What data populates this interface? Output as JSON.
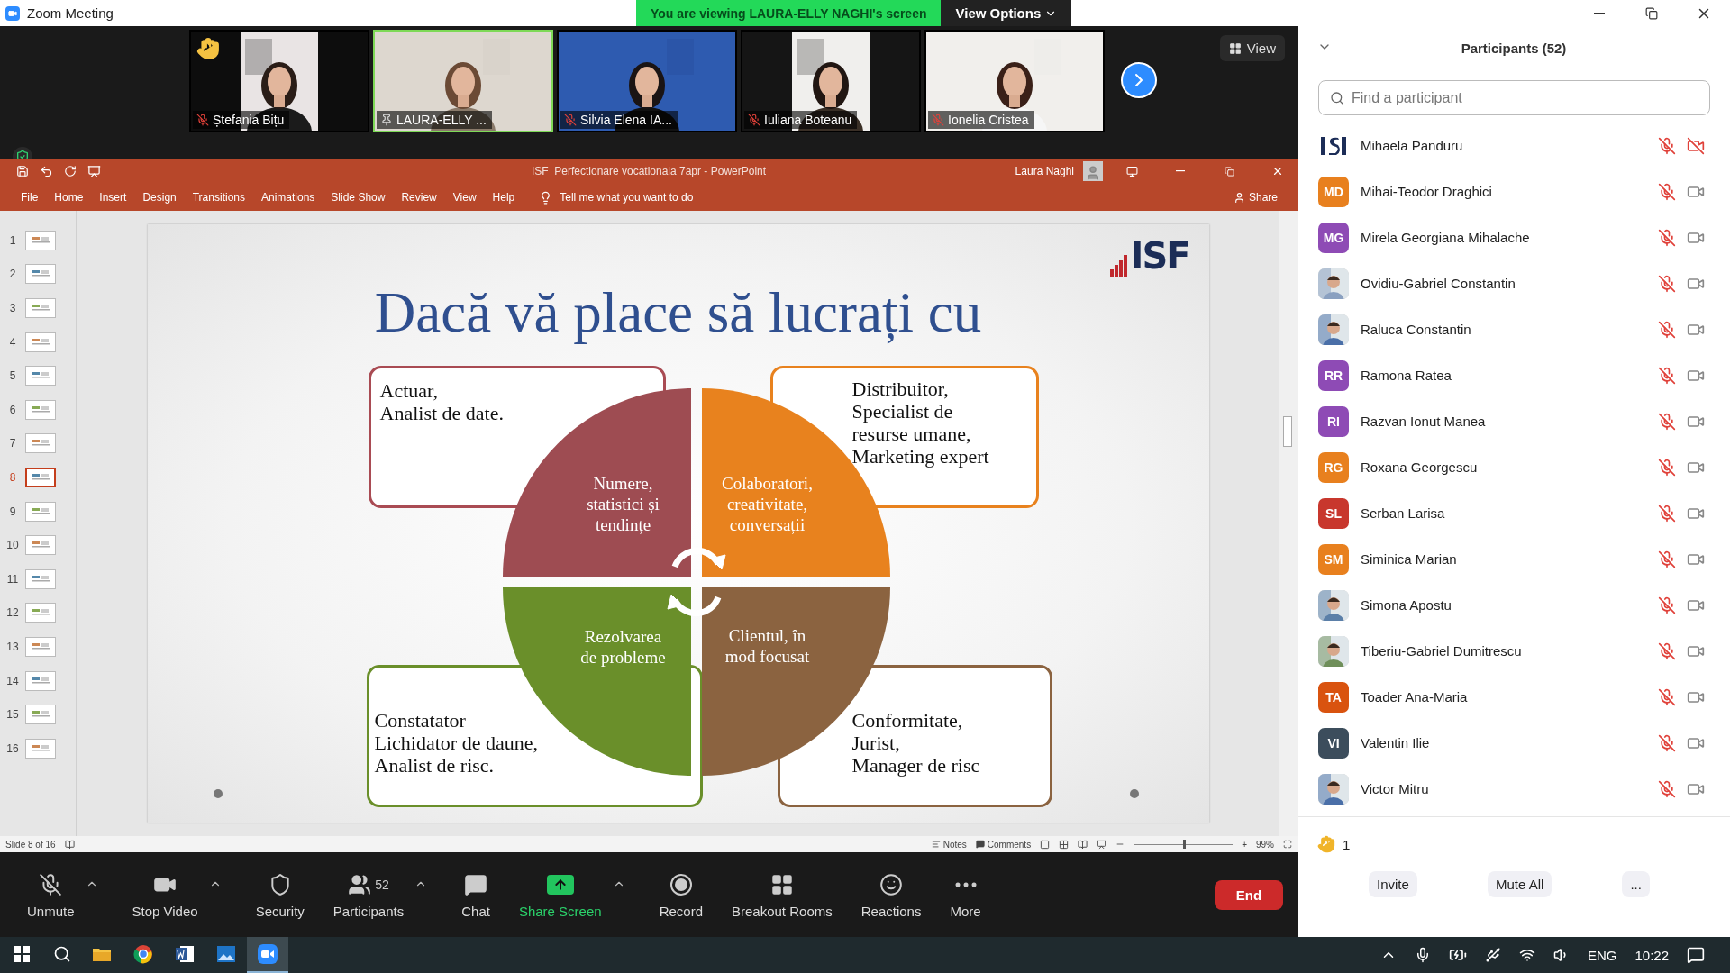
{
  "window": {
    "title": "Zoom Meeting"
  },
  "share_banner": {
    "text": "You are viewing LAURA-ELLY NAGHI's screen",
    "options": "View Options"
  },
  "videos": [
    {
      "name": "Ștefania Bițu",
      "muted": true,
      "pinned": false,
      "hand_raised": true,
      "active": false
    },
    {
      "name": "LAURA-ELLY ...",
      "muted": false,
      "pinned": true,
      "hand_raised": false,
      "active": true
    },
    {
      "name": "Silvia Elena IA...",
      "muted": true,
      "pinned": false,
      "hand_raised": false,
      "active": false
    },
    {
      "name": "Iuliana Boteanu",
      "muted": true,
      "pinned": false,
      "hand_raised": false,
      "active": false
    },
    {
      "name": "Ionelia Cristea",
      "muted": true,
      "pinned": false,
      "hand_raised": false,
      "active": false
    }
  ],
  "view_button": "View",
  "powerpoint": {
    "title": "ISF_Perfectionare vocationala 7apr  -  PowerPoint",
    "user": "Laura Naghi",
    "tabs": [
      "File",
      "Home",
      "Insert",
      "Design",
      "Transitions",
      "Animations",
      "Slide Show",
      "Review",
      "View",
      "Help"
    ],
    "tell_me": "Tell me what you want to do",
    "share": "Share",
    "thumbnails": [
      {
        "number": "1",
        "selected": false
      },
      {
        "number": "2",
        "selected": false
      },
      {
        "number": "3",
        "selected": false
      },
      {
        "number": "4",
        "selected": false
      },
      {
        "number": "5",
        "selected": false
      },
      {
        "number": "6",
        "selected": false
      },
      {
        "number": "7",
        "selected": false
      },
      {
        "number": "8",
        "selected": true
      },
      {
        "number": "9",
        "selected": false
      },
      {
        "number": "10",
        "selected": false
      },
      {
        "number": "11",
        "selected": false
      },
      {
        "number": "12",
        "selected": false
      },
      {
        "number": "13",
        "selected": false
      },
      {
        "number": "14",
        "selected": false
      },
      {
        "number": "15",
        "selected": false
      },
      {
        "number": "16",
        "selected": false
      }
    ],
    "slide": {
      "logo": "ISF",
      "title": "Dacă vă place să lucrați cu",
      "roles": [
        {
          "text": "Actuar,\nAnalist de date.",
          "color": "#a94b53"
        },
        {
          "text": "Distribuitor,\nSpecialist de\nresurse umane,\nMarketing expert",
          "color": "#e8821e"
        },
        {
          "text": "Constatator\n Lichidator de daune,\n Analist de risc.",
          "color": "#6a8f2a"
        },
        {
          "text": "Conformitate,\nJurist,\n Manager de risc",
          "color": "#8b6340"
        }
      ],
      "sectors": [
        {
          "text": "Numere,\nstatistici și\ntendințe",
          "color": "#9e4c52"
        },
        {
          "text": "Colaboratori,\ncreativitate,\nconversații",
          "color": "#e8821e"
        },
        {
          "text": "Rezolvarea\nde probleme",
          "color": "#6a8f2a"
        },
        {
          "text": "Clientul, în\nmod focusat",
          "color": "#8b6340"
        }
      ]
    },
    "status": {
      "slide": "Slide 8 of 16",
      "notes": "Notes",
      "comments": "Comments",
      "zoom_in": "+",
      "zoom": "99%",
      "level": 0.5
    }
  },
  "toolbar": [
    {
      "kind": "mic",
      "label": "Unmute",
      "caret": true
    },
    {
      "kind": "video",
      "label": "Stop Video",
      "caret": true
    },
    {
      "kind": "security",
      "label": "Security",
      "caret": false
    },
    {
      "kind": "participants",
      "label": "Participants",
      "count": "52",
      "caret": true
    },
    {
      "kind": "chat",
      "label": "Chat",
      "caret": false
    },
    {
      "kind": "share",
      "label": "Share Screen",
      "caret": true
    },
    {
      "kind": "record",
      "label": "Record",
      "caret": false
    },
    {
      "kind": "breakout",
      "label": "Breakout Rooms",
      "caret": false
    },
    {
      "kind": "reactions",
      "label": "Reactions",
      "caret": false
    },
    {
      "kind": "more",
      "label": "More",
      "caret": false
    }
  ],
  "end_button": "End",
  "participants": {
    "title": "Participants (52)",
    "search_placeholder": "Find a participant",
    "items": [
      {
        "name": "Mihaela Panduru",
        "kind": "logo",
        "muted": true,
        "video_off": true
      },
      {
        "name": "Mihai-Teodor Draghici",
        "kind": "initials",
        "initials": "MD",
        "color": "#e8801e",
        "muted": true,
        "video_off": false
      },
      {
        "name": "Mirela Georgiana Mihalache",
        "kind": "initials",
        "initials": "MG",
        "color": "#8e4bb5",
        "muted": true,
        "video_off": false
      },
      {
        "name": "Ovidiu-Gabriel Constantin",
        "muted": true,
        "video_off": false
      },
      {
        "name": "Raluca Constantin",
        "muted": true,
        "video_off": false
      },
      {
        "name": "Ramona Ratea",
        "kind": "initials",
        "initials": "RR",
        "color": "#8e4bb5",
        "muted": true,
        "video_off": false
      },
      {
        "name": "Razvan Ionut Manea",
        "kind": "initials",
        "initials": "RI",
        "color": "#8e4bb5",
        "muted": true,
        "video_off": false
      },
      {
        "name": "Roxana Georgescu",
        "kind": "initials",
        "initials": "RG",
        "color": "#e8801e",
        "muted": true,
        "video_off": false
      },
      {
        "name": "Serban Larisa",
        "kind": "initials",
        "initials": "SL",
        "color": "#c8372d",
        "muted": true,
        "video_off": false
      },
      {
        "name": "Siminica Marian",
        "kind": "initials",
        "initials": "SM",
        "color": "#e8801e",
        "muted": true,
        "video_off": false
      },
      {
        "name": "Simona Apostu",
        "muted": true,
        "video_off": false
      },
      {
        "name": "Tiberiu-Gabriel Dumitrescu",
        "muted": true,
        "video_off": false
      },
      {
        "name": "Toader Ana-Maria",
        "kind": "initials",
        "initials": "TA",
        "color": "#d9530f",
        "muted": true,
        "video_off": false
      },
      {
        "name": "Valentin Ilie",
        "kind": "initials",
        "initials": "VI",
        "color": "#3c4d5c",
        "muted": true,
        "video_off": false
      },
      {
        "name": "Victor Mitru",
        "muted": true,
        "video_off": false
      }
    ],
    "raised_hands": "1",
    "buttons": [
      "Invite",
      "Mute All",
      "..."
    ]
  },
  "taskbar": {
    "apps": [
      {
        "kind": "explorer",
        "active": false
      },
      {
        "kind": "chrome",
        "active": false
      },
      {
        "kind": "word",
        "active": false
      },
      {
        "kind": "photos",
        "active": false
      },
      {
        "kind": "zoom",
        "active": true
      }
    ],
    "language": "ENG",
    "time": "10:22"
  }
}
